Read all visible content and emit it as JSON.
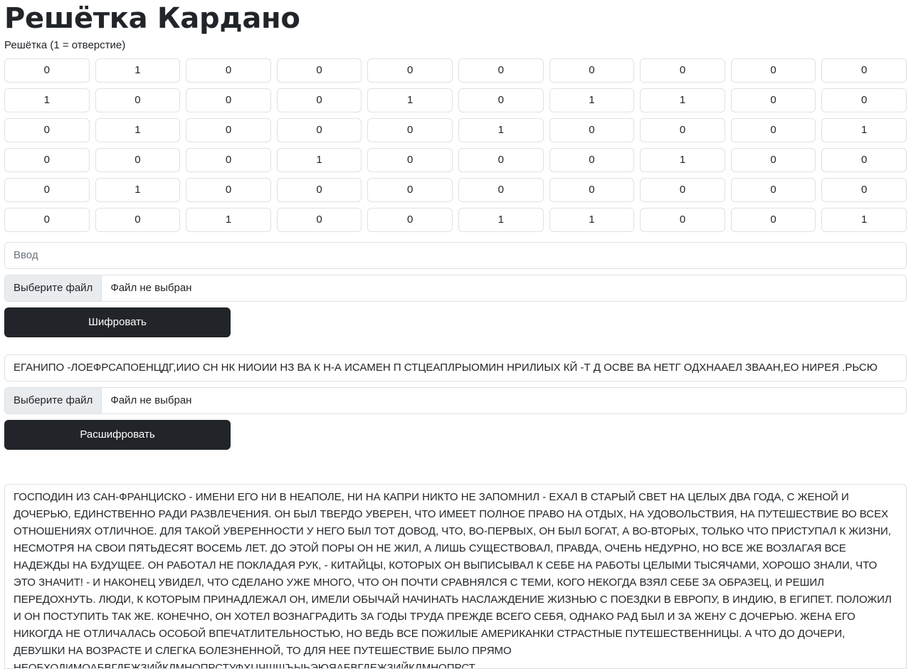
{
  "page": {
    "title": "Решётка Кардано",
    "grid_label": "Решётка (1 = отверстие)"
  },
  "grid": [
    [
      "0",
      "1",
      "0",
      "0",
      "0",
      "0",
      "0",
      "0",
      "0",
      "0"
    ],
    [
      "1",
      "0",
      "0",
      "0",
      "1",
      "0",
      "1",
      "1",
      "0",
      "0"
    ],
    [
      "0",
      "1",
      "0",
      "0",
      "0",
      "1",
      "0",
      "0",
      "0",
      "1"
    ],
    [
      "0",
      "0",
      "0",
      "1",
      "0",
      "0",
      "0",
      "1",
      "0",
      "0"
    ],
    [
      "0",
      "1",
      "0",
      "0",
      "0",
      "0",
      "0",
      "0",
      "0",
      "0"
    ],
    [
      "0",
      "0",
      "1",
      "0",
      "0",
      "1",
      "1",
      "0",
      "0",
      "1"
    ]
  ],
  "encrypt": {
    "input_placeholder": "Ввод",
    "file_button": "Выберите файл",
    "file_status": "Файл не выбран",
    "submit_label": "Шифровать"
  },
  "decrypt": {
    "input_value": "ЕГАНИПО -ЛОЕФРСАПОЕНЦДГ,ИИО СН НК НИОИИ НЗ ВА  К Н-А  ИСАМЕН П СТЦЕАПЛРЫОМИН НРИЛИЫХ КЙ -Т Д ОСВЕ ВА НЕТГ ОДХНААЕЛ  ЗВААН,ЕО НИРЕЯ .РЬСЮ",
    "file_button": "Выберите файл",
    "file_status": "Файл не выбран",
    "submit_label": "Расшифровать"
  },
  "output": {
    "text": "ГОСПОДИН ИЗ САН-ФРАНЦИСКО - ИМЕНИ ЕГО НИ В НЕАПОЛЕ, НИ НА КАПРИ НИКТО НЕ ЗАПОМНИЛ - ЕХАЛ В СТАРЫЙ СВЕТ НА ЦЕЛЫХ ДВА ГОДА, С ЖЕНОЙ И ДОЧЕРЬЮ, ЕДИНСТВЕННО РАДИ РАЗВЛЕЧЕНИЯ. ОН БЫЛ ТВЕРДО УВЕРЕН, ЧТО ИМЕЕТ ПОЛНОЕ ПРАВО НА ОТДЫХ, НА УДОВОЛЬСТВИЯ, НА ПУТЕШЕСТВИЕ ВО ВСЕХ ОТНОШЕНИЯХ ОТЛИЧНОЕ. ДЛЯ ТАКОЙ УВЕРЕННОСТИ У НЕГО БЫЛ ТОТ ДОВОД, ЧТО, ВО-ПЕРВЫХ, ОН БЫЛ БОГАТ, А ВО-ВТОРЫХ, ТОЛЬКО ЧТО ПРИСТУПАЛ К ЖИЗНИ, НЕСМОТРЯ НА СВОИ ПЯТЬДЕСЯТ ВОСЕМЬ ЛЕТ. ДО ЭТОЙ ПОРЫ ОН НЕ ЖИЛ, А ЛИШЬ СУЩЕСТВОВАЛ, ПРАВДА, ОЧЕНЬ НЕДУРНО, НО ВСЕ ЖЕ ВОЗЛАГАЯ ВСЕ НАДЕЖДЫ НА БУДУЩЕЕ. ОН РАБОТАЛ НЕ ПОКЛАДАЯ РУК, - КИТАЙЦЫ, КОТОРЫХ ОН ВЫПИСЫВАЛ К СЕБЕ НА РАБОТЫ ЦЕЛЫМИ ТЫСЯЧАМИ, ХОРОШО ЗНАЛИ, ЧТО ЭТО ЗНАЧИТ! - И НАКОНЕЦ УВИДЕЛ, ЧТО СДЕЛАНО УЖЕ МНОГО, ЧТО ОН ПОЧТИ СРАВНЯЛСЯ С ТЕМИ, КОГО НЕКОГДА ВЗЯЛ СЕБЕ ЗА ОБРАЗЕЦ, И РЕШИЛ ПЕРЕДОХНУТЬ. ЛЮДИ, К КОТОРЫМ ПРИНАДЛЕЖАЛ ОН, ИМЕЛИ ОБЫЧАЙ НАЧИНАТЬ НАСЛАЖДЕНИЕ ЖИЗНЬЮ С ПОЕЗДКИ В ЕВРОПУ, В ИНДИЮ, В ЕГИПЕТ. ПОЛОЖИЛ И ОН ПОСТУПИТЬ ТАК ЖЕ. КОНЕЧНО, ОН ХОТЕЛ ВОЗНАГРАДИТЬ ЗА ГОДЫ ТРУДА ПРЕЖДЕ ВСЕГО СЕБЯ, ОДНАКО РАД БЫЛ И ЗА ЖЕНУ С ДОЧЕРЬЮ. ЖЕНА ЕГО НИКОГДА НЕ ОТЛИЧАЛАСЬ ОСОБОЙ ВПЕЧАТЛИТЕЛЬНОСТЬЮ, НО ВЕДЬ ВСЕ ПОЖИЛЫЕ АМЕРИКАНКИ СТРАСТНЫЕ ПУТЕШЕСТВЕННИЦЫ. А ЧТО ДО ДОЧЕРИ, ДЕВУШКИ НА ВОЗРАСТЕ И СЛЕГКА БОЛЕЗНЕННОЙ, ТО ДЛЯ НЕЕ ПУТЕШЕСТВИЕ БЫЛО ПРЯМО НЕОБХОДИМОАБВГДЕЖЗИЙКЛМНОПРСТУФХЦЧШЩЪЫЬЭЮЯАБВГДЕЖЗИЙКЛМНОПРСТ"
  }
}
